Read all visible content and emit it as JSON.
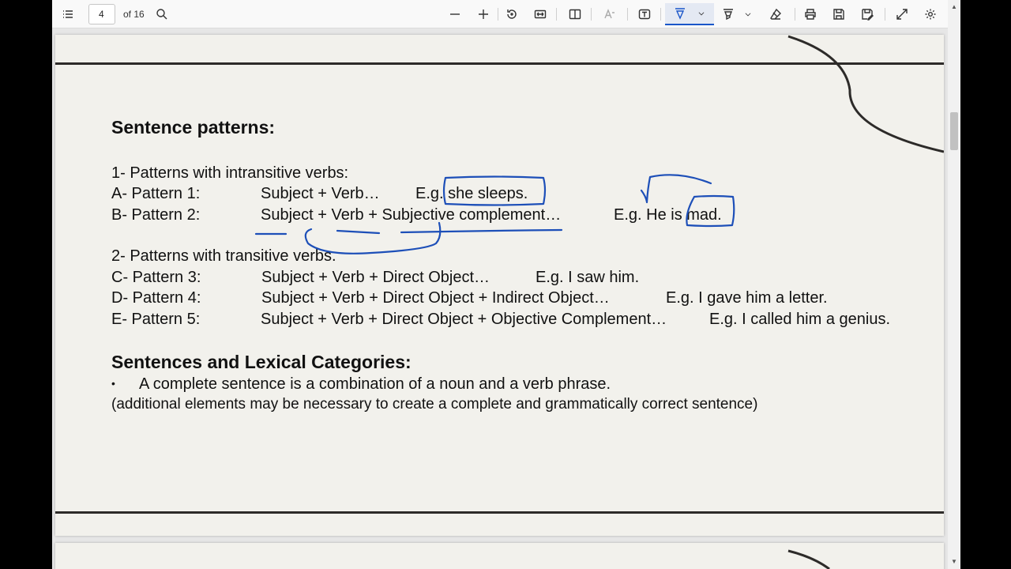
{
  "toolbar": {
    "page_number": "4",
    "page_total": "of 16",
    "icons": [
      "contents-icon",
      "search-icon",
      "zoom-out-icon",
      "zoom-in-icon",
      "rotate-icon",
      "fit-page-icon",
      "page-view-icon",
      "read-aloud-icon",
      "add-text-icon",
      "draw-icon",
      "highlight-icon",
      "erase-icon",
      "print-icon",
      "save-icon",
      "save-as-icon",
      "fullscreen-icon",
      "settings-icon"
    ]
  },
  "document": {
    "heading1": "Sentence patterns:",
    "intransitive_title": "1- Patterns with intransitive verbs:",
    "rows_intransitive": [
      {
        "label": "A- Pattern 1:",
        "pattern": "Subject + Verb…",
        "example": "E.g. she sleeps."
      },
      {
        "label": "B- Pattern 2:",
        "pattern": "Subject + Verb + Subjective complement…",
        "example": "E.g. He is mad."
      }
    ],
    "transitive_title": "2- Patterns with transitive verbs.",
    "rows_transitive": [
      {
        "label": "C- Pattern 3:",
        "pattern": "Subject + Verb + Direct Object…",
        "example": "E.g. I saw him."
      },
      {
        "label": "D- Pattern 4:",
        "pattern": "Subject + Verb + Direct Object + Indirect Object…",
        "example": "E.g. I gave him a letter."
      },
      {
        "label": "E- Pattern 5:",
        "pattern": "Subject + Verb + Direct Object + Objective Complement…",
        "example": "E.g. I called him a genius."
      }
    ],
    "heading2": "Sentences and Lexical Categories:",
    "bullet": "•",
    "bullet_text": "A complete sentence is a combination of a noun and a verb phrase.",
    "note": "(additional elements may be necessary to create a complete and grammatically correct sentence)"
  },
  "colors": {
    "ink_annotation": "#1d4fb8",
    "page_bg": "#f2f1ec",
    "rule": "#2d2b29"
  }
}
